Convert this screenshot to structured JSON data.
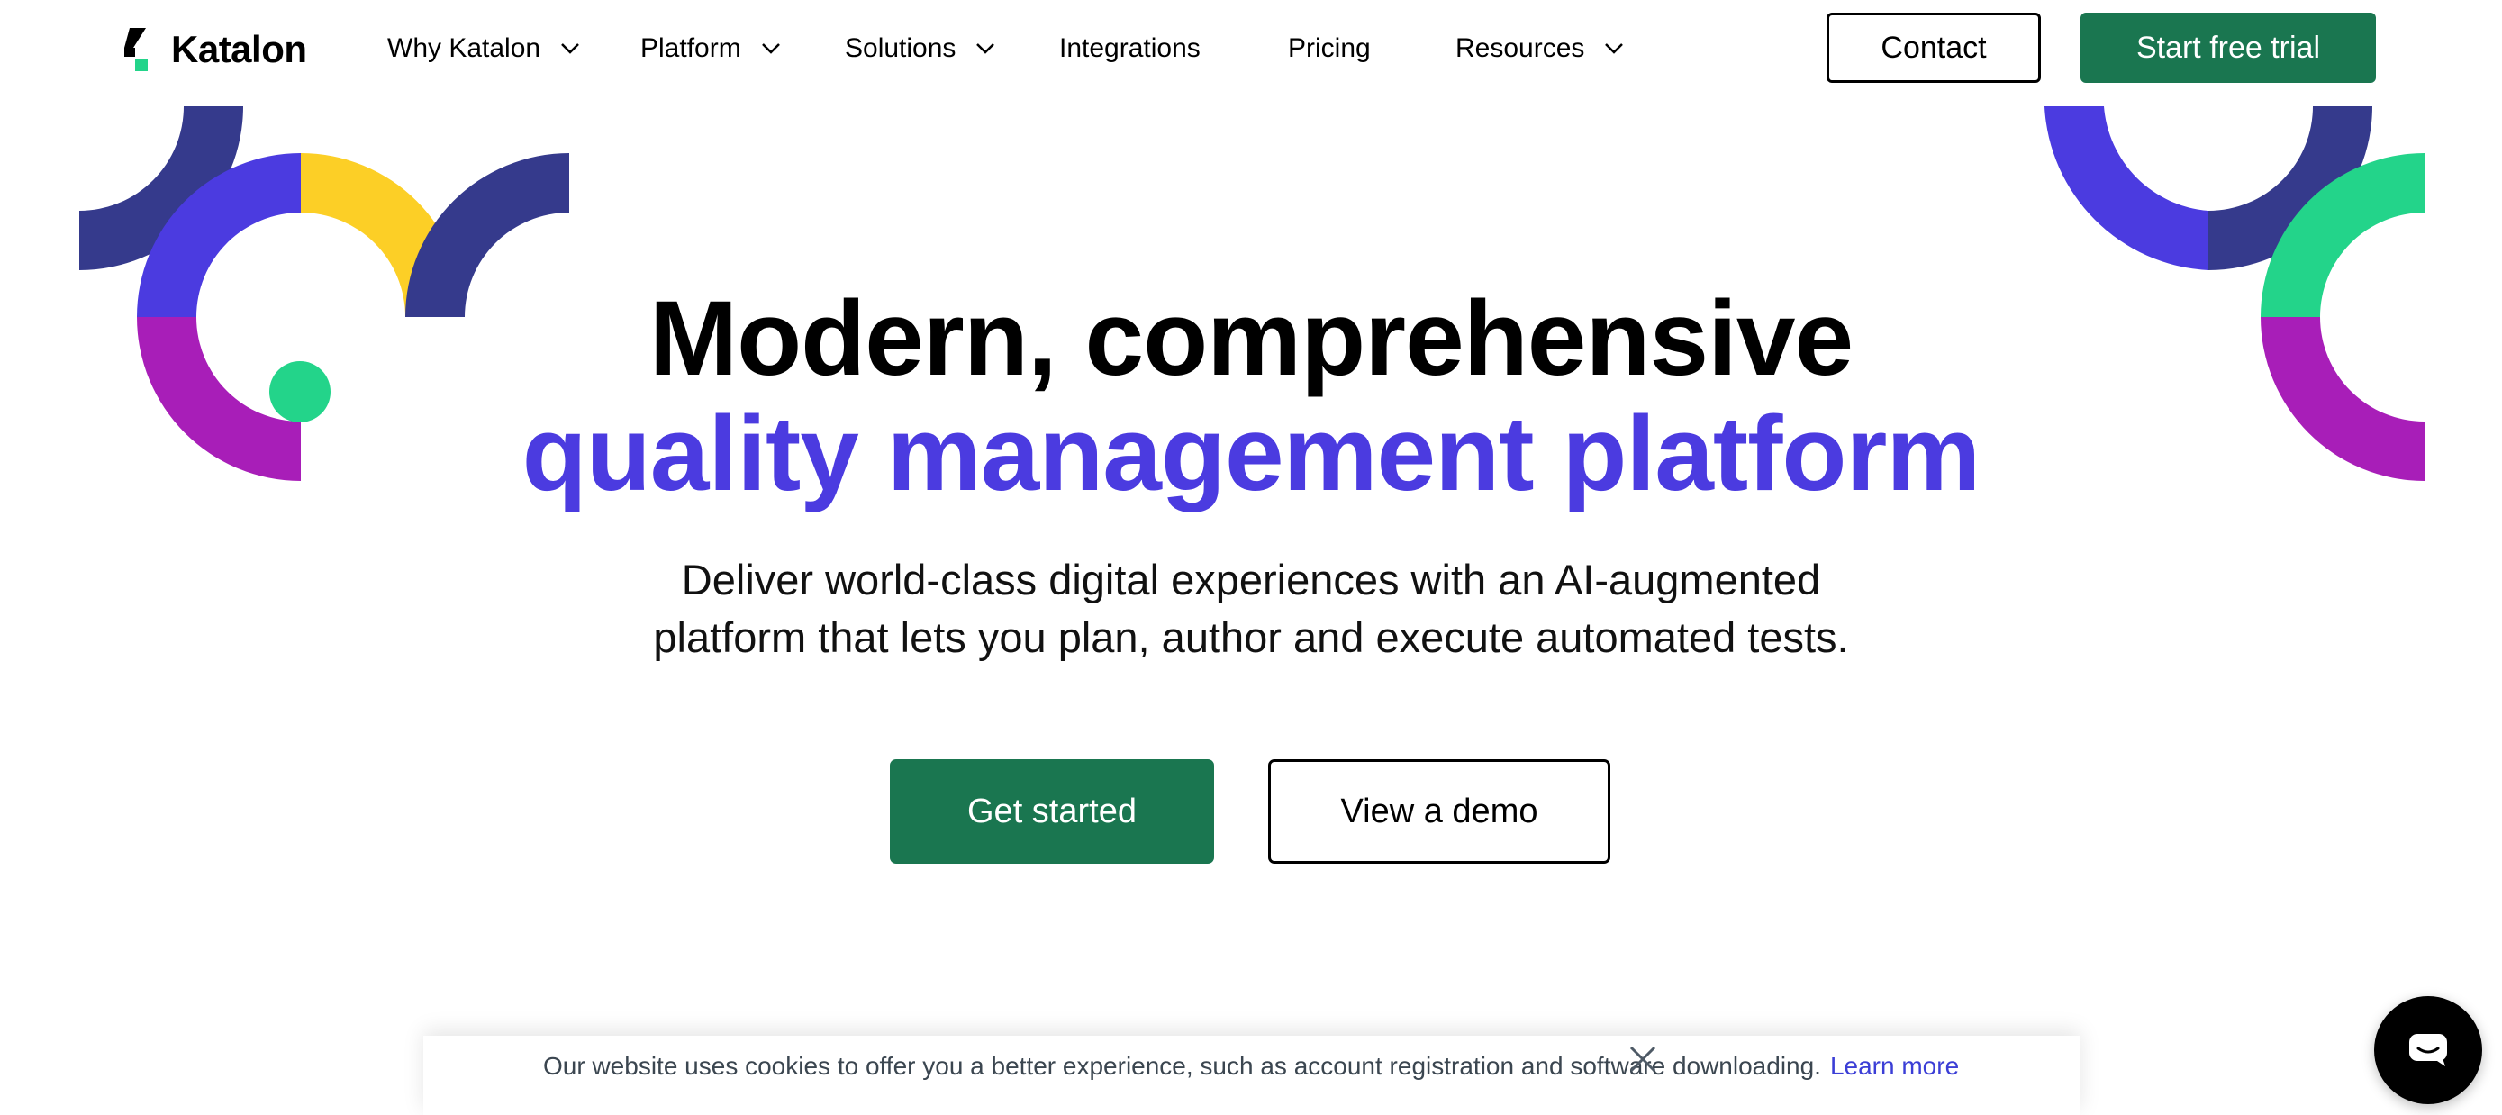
{
  "brand": {
    "name": "Katalon",
    "colors": {
      "green": "#1a7650",
      "purple": "#4b3be0",
      "navy": "#353a8c",
      "magenta": "#a81eb8",
      "yellow": "#fccf26",
      "mint": "#23d48a"
    }
  },
  "nav": {
    "items": [
      {
        "label": "Why Katalon",
        "has_dropdown": true
      },
      {
        "label": "Platform",
        "has_dropdown": true
      },
      {
        "label": "Solutions",
        "has_dropdown": true
      },
      {
        "label": "Integrations",
        "has_dropdown": false
      },
      {
        "label": "Pricing",
        "has_dropdown": false
      },
      {
        "label": "Resources",
        "has_dropdown": true
      }
    ],
    "contact_label": "Contact",
    "trial_label": "Start free trial"
  },
  "hero": {
    "title_line1": "Modern, comprehensive",
    "title_line2": "quality management platform",
    "subtitle_line1": "Deliver world-class digital experiences with an AI-augmented",
    "subtitle_line2": "platform that lets you plan, author and execute automated tests.",
    "primary_cta": "Get started",
    "secondary_cta": "View a demo"
  },
  "cookie": {
    "text": "Our website uses cookies to offer you a better experience, such as account registration and software downloading.",
    "link": "Learn more",
    "close_icon": "close-icon"
  },
  "chat": {
    "icon": "chat-bubble-icon"
  }
}
